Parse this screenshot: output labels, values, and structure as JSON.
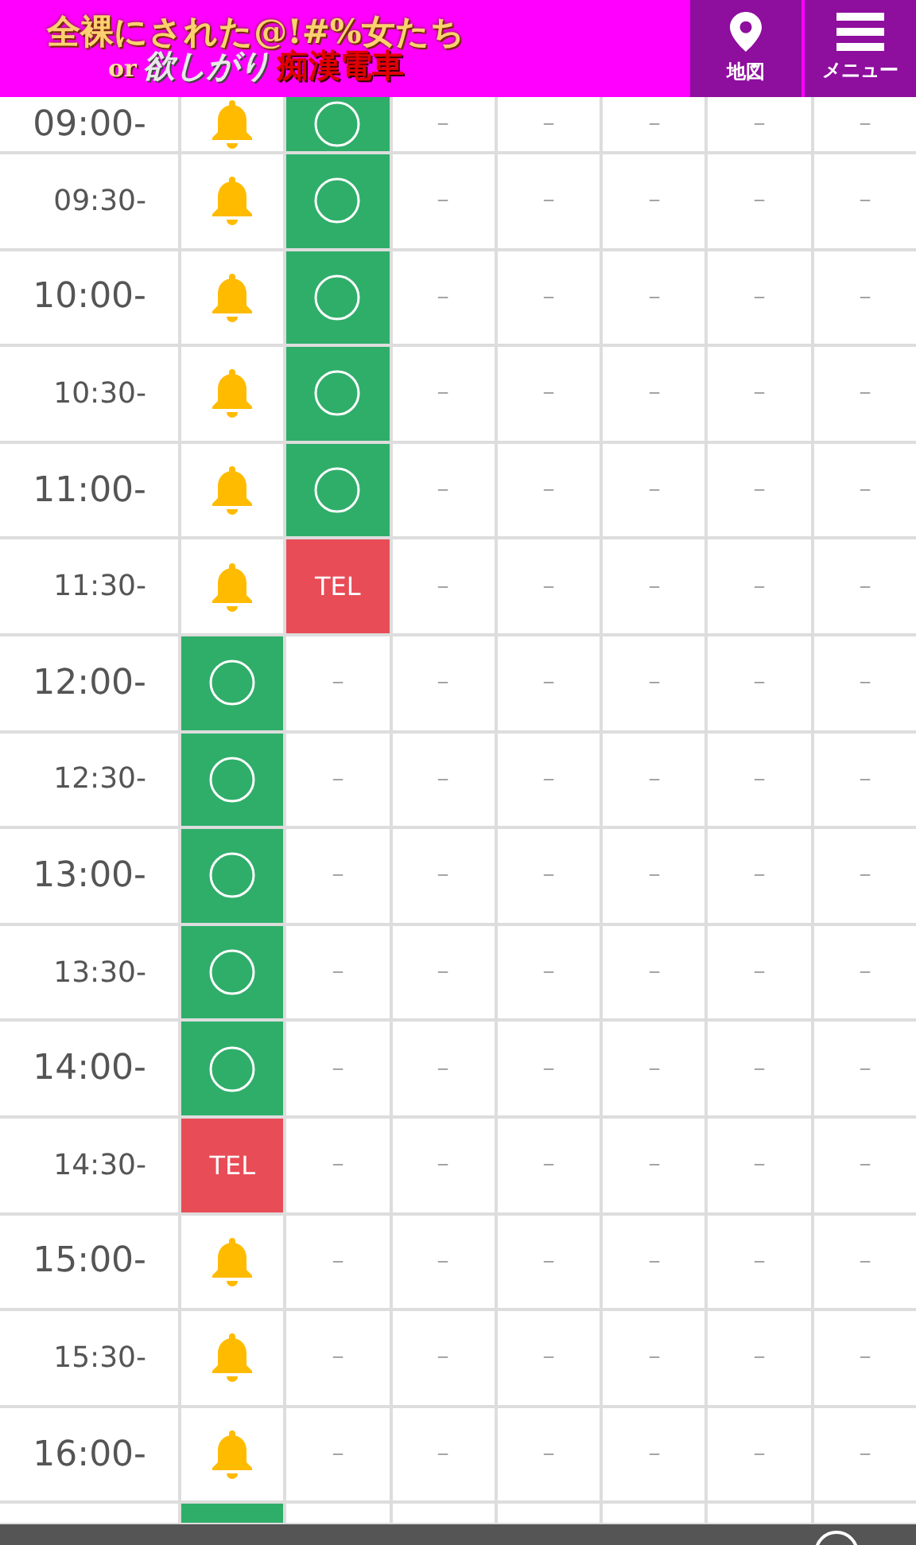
{
  "header": {
    "logo": {
      "line1": "全裸にされた@!#%女たち",
      "line2_prefix": "or",
      "line2_mid": "欲しがり",
      "line2_end": "痴漢電車"
    },
    "buttons": [
      {
        "label": "地図",
        "kind": "map"
      },
      {
        "label": "メニュー",
        "kind": "menu"
      }
    ]
  },
  "schedule": {
    "rows": [
      {
        "time": "09:00-",
        "kind": "hour",
        "cells": [
          {
            "kind": "bell"
          },
          {
            "kind": "open"
          },
          {
            "kind": "none",
            "text": "－"
          },
          {
            "kind": "none",
            "text": "－"
          },
          {
            "kind": "none",
            "text": "－"
          },
          {
            "kind": "none",
            "text": "－"
          },
          {
            "kind": "none",
            "text": "－"
          }
        ]
      },
      {
        "time": "09:30-",
        "kind": "half",
        "cells": [
          {
            "kind": "bell"
          },
          {
            "kind": "open"
          },
          {
            "kind": "none",
            "text": "－"
          },
          {
            "kind": "none",
            "text": "－"
          },
          {
            "kind": "none",
            "text": "－"
          },
          {
            "kind": "none",
            "text": "－"
          },
          {
            "kind": "none",
            "text": "－"
          }
        ]
      },
      {
        "time": "10:00-",
        "kind": "hour",
        "cells": [
          {
            "kind": "bell"
          },
          {
            "kind": "open"
          },
          {
            "kind": "none",
            "text": "－"
          },
          {
            "kind": "none",
            "text": "－"
          },
          {
            "kind": "none",
            "text": "－"
          },
          {
            "kind": "none",
            "text": "－"
          },
          {
            "kind": "none",
            "text": "－"
          }
        ]
      },
      {
        "time": "10:30-",
        "kind": "half",
        "cells": [
          {
            "kind": "bell"
          },
          {
            "kind": "open"
          },
          {
            "kind": "none",
            "text": "－"
          },
          {
            "kind": "none",
            "text": "－"
          },
          {
            "kind": "none",
            "text": "－"
          },
          {
            "kind": "none",
            "text": "－"
          },
          {
            "kind": "none",
            "text": "－"
          }
        ]
      },
      {
        "time": "11:00-",
        "kind": "hour",
        "cells": [
          {
            "kind": "bell"
          },
          {
            "kind": "open"
          },
          {
            "kind": "none",
            "text": "－"
          },
          {
            "kind": "none",
            "text": "－"
          },
          {
            "kind": "none",
            "text": "－"
          },
          {
            "kind": "none",
            "text": "－"
          },
          {
            "kind": "none",
            "text": "－"
          }
        ]
      },
      {
        "time": "11:30-",
        "kind": "half",
        "cells": [
          {
            "kind": "bell"
          },
          {
            "kind": "tel",
            "text": "TEL"
          },
          {
            "kind": "none",
            "text": "－"
          },
          {
            "kind": "none",
            "text": "－"
          },
          {
            "kind": "none",
            "text": "－"
          },
          {
            "kind": "none",
            "text": "－"
          },
          {
            "kind": "none",
            "text": "－"
          }
        ]
      },
      {
        "time": "12:00-",
        "kind": "hour",
        "cells": [
          {
            "kind": "open"
          },
          {
            "kind": "none",
            "text": "－"
          },
          {
            "kind": "none",
            "text": "－"
          },
          {
            "kind": "none",
            "text": "－"
          },
          {
            "kind": "none",
            "text": "－"
          },
          {
            "kind": "none",
            "text": "－"
          },
          {
            "kind": "none",
            "text": "－"
          }
        ]
      },
      {
        "time": "12:30-",
        "kind": "half",
        "cells": [
          {
            "kind": "open"
          },
          {
            "kind": "none",
            "text": "－"
          },
          {
            "kind": "none",
            "text": "－"
          },
          {
            "kind": "none",
            "text": "－"
          },
          {
            "kind": "none",
            "text": "－"
          },
          {
            "kind": "none",
            "text": "－"
          },
          {
            "kind": "none",
            "text": "－"
          }
        ]
      },
      {
        "time": "13:00-",
        "kind": "hour",
        "cells": [
          {
            "kind": "open"
          },
          {
            "kind": "none",
            "text": "－"
          },
          {
            "kind": "none",
            "text": "－"
          },
          {
            "kind": "none",
            "text": "－"
          },
          {
            "kind": "none",
            "text": "－"
          },
          {
            "kind": "none",
            "text": "－"
          },
          {
            "kind": "none",
            "text": "－"
          }
        ]
      },
      {
        "time": "13:30-",
        "kind": "half",
        "cells": [
          {
            "kind": "open"
          },
          {
            "kind": "none",
            "text": "－"
          },
          {
            "kind": "none",
            "text": "－"
          },
          {
            "kind": "none",
            "text": "－"
          },
          {
            "kind": "none",
            "text": "－"
          },
          {
            "kind": "none",
            "text": "－"
          },
          {
            "kind": "none",
            "text": "－"
          }
        ]
      },
      {
        "time": "14:00-",
        "kind": "hour",
        "cells": [
          {
            "kind": "open"
          },
          {
            "kind": "none",
            "text": "－"
          },
          {
            "kind": "none",
            "text": "－"
          },
          {
            "kind": "none",
            "text": "－"
          },
          {
            "kind": "none",
            "text": "－"
          },
          {
            "kind": "none",
            "text": "－"
          },
          {
            "kind": "none",
            "text": "－"
          }
        ]
      },
      {
        "time": "14:30-",
        "kind": "half",
        "cells": [
          {
            "kind": "tel",
            "text": "TEL"
          },
          {
            "kind": "none",
            "text": "－"
          },
          {
            "kind": "none",
            "text": "－"
          },
          {
            "kind": "none",
            "text": "－"
          },
          {
            "kind": "none",
            "text": "－"
          },
          {
            "kind": "none",
            "text": "－"
          },
          {
            "kind": "none",
            "text": "－"
          }
        ]
      },
      {
        "time": "15:00-",
        "kind": "hour",
        "cells": [
          {
            "kind": "bell"
          },
          {
            "kind": "none",
            "text": "－"
          },
          {
            "kind": "none",
            "text": "－"
          },
          {
            "kind": "none",
            "text": "－"
          },
          {
            "kind": "none",
            "text": "－"
          },
          {
            "kind": "none",
            "text": "－"
          },
          {
            "kind": "none",
            "text": "－"
          }
        ]
      },
      {
        "time": "15:30-",
        "kind": "half",
        "cells": [
          {
            "kind": "bell"
          },
          {
            "kind": "none",
            "text": "－"
          },
          {
            "kind": "none",
            "text": "－"
          },
          {
            "kind": "none",
            "text": "－"
          },
          {
            "kind": "none",
            "text": "－"
          },
          {
            "kind": "none",
            "text": "－"
          },
          {
            "kind": "none",
            "text": "－"
          }
        ]
      },
      {
        "time": "16:00-",
        "kind": "hour",
        "cells": [
          {
            "kind": "bell"
          },
          {
            "kind": "none",
            "text": "－"
          },
          {
            "kind": "none",
            "text": "－"
          },
          {
            "kind": "none",
            "text": "－"
          },
          {
            "kind": "none",
            "text": "－"
          },
          {
            "kind": "none",
            "text": "－"
          },
          {
            "kind": "none",
            "text": "－"
          }
        ]
      },
      {
        "kind": "partial",
        "cells": [
          {
            "kind": "open"
          },
          {
            "kind": "empty"
          },
          {
            "kind": "empty"
          },
          {
            "kind": "empty"
          },
          {
            "kind": "empty"
          },
          {
            "kind": "empty"
          },
          {
            "kind": "empty"
          }
        ]
      }
    ]
  }
}
